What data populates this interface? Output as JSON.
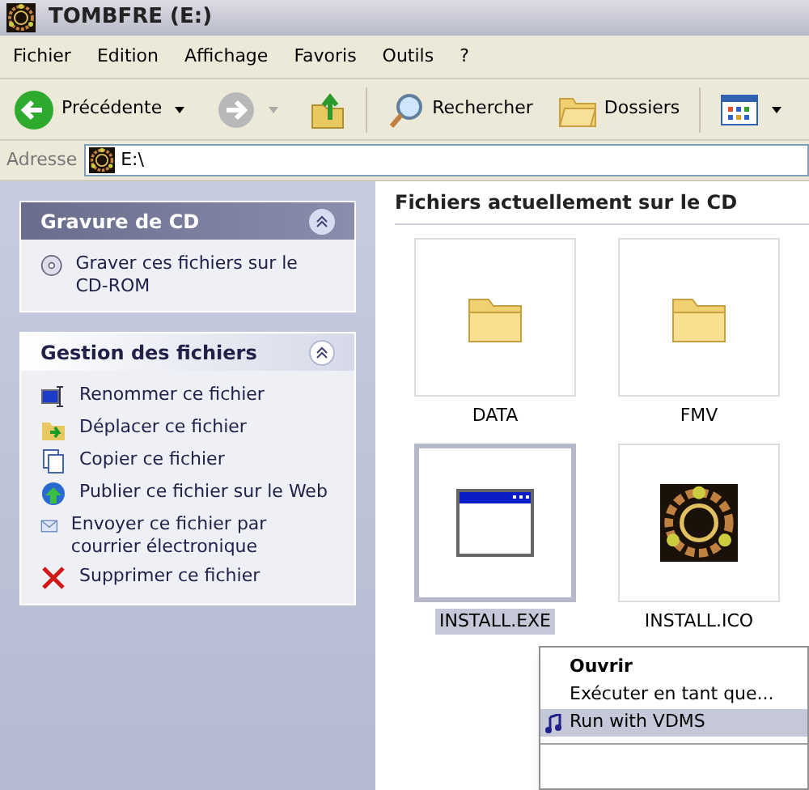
{
  "window": {
    "title": "TOMBFRE (E:)"
  },
  "menu_bar": [
    "Fichier",
    "Edition",
    "Affichage",
    "Favoris",
    "Outils",
    "?"
  ],
  "toolbar": {
    "back": "Précédente",
    "search": "Rechercher",
    "folders": "Dossiers"
  },
  "address": {
    "label": "Adresse",
    "value": "E:\\"
  },
  "task_panels": [
    {
      "title": "Gravure de CD",
      "special": true,
      "items": [
        {
          "kind": "cd",
          "label": "Graver ces fichiers sur le CD-ROM"
        }
      ]
    },
    {
      "title": "Gestion des fichiers",
      "special": false,
      "items": [
        {
          "kind": "rename",
          "label": "Renommer ce fichier"
        },
        {
          "kind": "move",
          "label": "Déplacer ce fichier"
        },
        {
          "kind": "copy",
          "label": "Copier ce fichier"
        },
        {
          "kind": "web",
          "label": "Publier ce fichier sur le Web"
        },
        {
          "kind": "mail",
          "label": "Envoyer ce fichier par courrier électronique"
        },
        {
          "kind": "delete",
          "label": "Supprimer ce fichier"
        }
      ]
    }
  ],
  "files_header": "Fichiers actuellement sur le CD",
  "files": [
    {
      "kind": "folder",
      "name": "DATA",
      "selected": false
    },
    {
      "kind": "folder",
      "name": "FMV",
      "selected": false
    },
    {
      "kind": "program",
      "name": "INSTALL.EXE",
      "selected": true
    },
    {
      "kind": "image",
      "name": "INSTALL.ICO",
      "selected": false
    }
  ],
  "context_menu": [
    {
      "label": "Ouvrir",
      "default": true,
      "icon": false,
      "selected": false
    },
    {
      "label": "Exécuter en tant que...",
      "default": false,
      "icon": false,
      "selected": false
    },
    {
      "label": "Run with VDMS",
      "default": false,
      "icon": true,
      "selected": true
    }
  ]
}
